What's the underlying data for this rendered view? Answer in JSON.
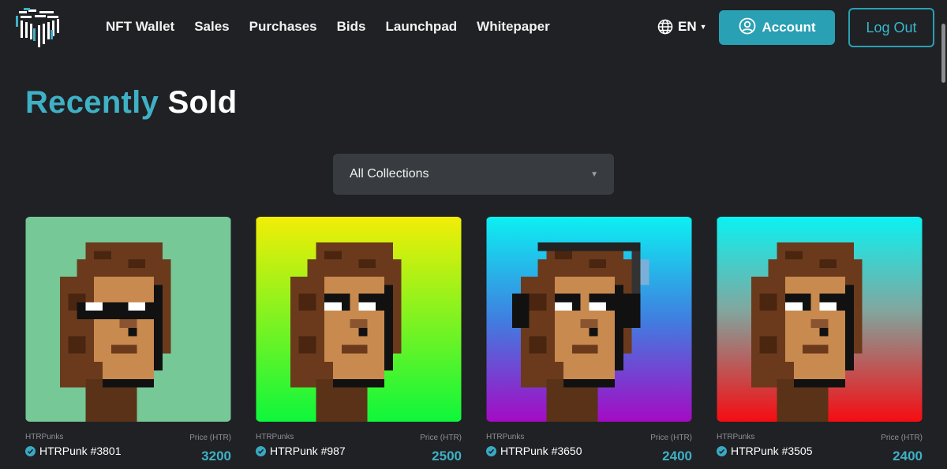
{
  "header": {
    "logo_icon": "htr-cube-logo",
    "nav": [
      {
        "label": "NFT Wallet"
      },
      {
        "label": "Sales"
      },
      {
        "label": "Purchases"
      },
      {
        "label": "Bids"
      },
      {
        "label": "Launchpad"
      },
      {
        "label": "Whitepaper"
      }
    ],
    "language": {
      "icon": "globe-icon",
      "label": "EN"
    },
    "account_button": {
      "icon": "user-circle-icon",
      "label": "Account"
    },
    "logout_button": {
      "label": "Log Out"
    }
  },
  "page": {
    "title_accent": "Recently",
    "title_rest": "Sold"
  },
  "filter": {
    "selected": "All Collections"
  },
  "cards": [
    {
      "collection": "HTRPunks",
      "name": "HTRPunk #3801",
      "price_label": "Price (HTR)",
      "price": "3200",
      "background": "mint",
      "accessory": "sunglasses"
    },
    {
      "collection": "HTRPunks",
      "name": "HTRPunk #987",
      "price_label": "Price (HTR)",
      "price": "2500",
      "background": "yellow-to-green gradient",
      "accessory": "none"
    },
    {
      "collection": "HTRPunks",
      "name": "HTRPunk #3650",
      "price_label": "Price (HTR)",
      "price": "2400",
      "background": "cyan-to-purple gradient",
      "accessory": "headphones"
    },
    {
      "collection": "HTRPunks",
      "name": "HTRPunk #3505",
      "price_label": "Price (HTR)",
      "price": "2400",
      "background": "cyan-to-red gradient",
      "accessory": "none"
    }
  ],
  "colors": {
    "background": "#1f2124",
    "accent": "#2aa0b4",
    "accent_text": "#3fb0c6",
    "select_bg": "#383b40"
  }
}
